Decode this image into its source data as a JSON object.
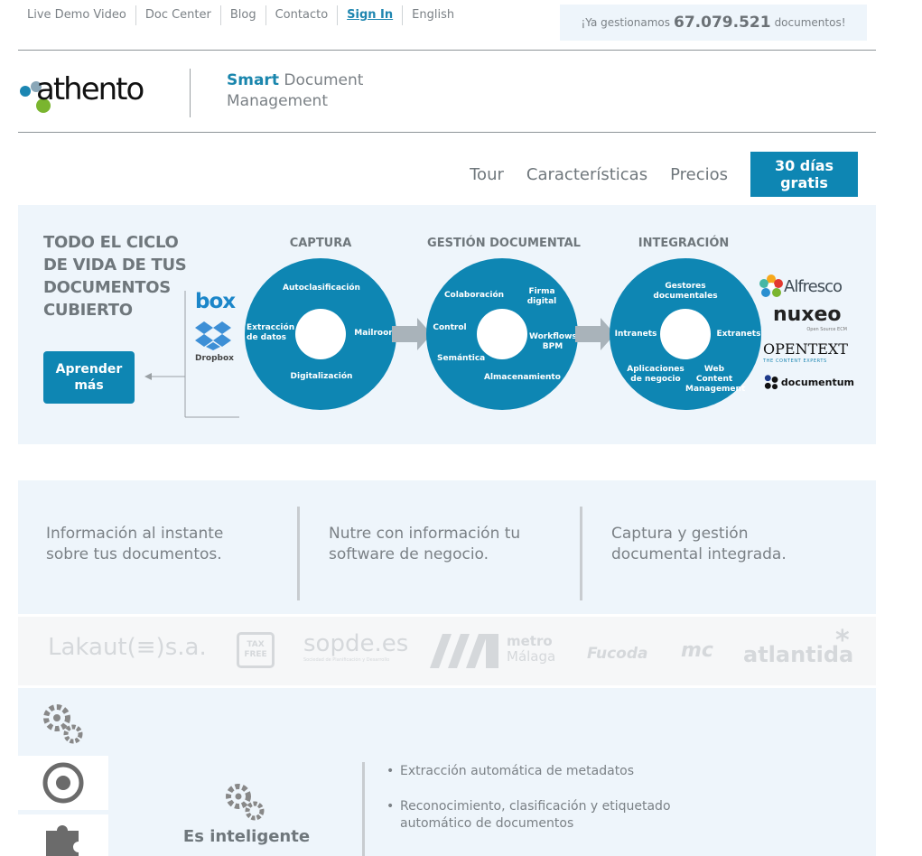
{
  "top_nav": {
    "items": [
      "Live Demo Video",
      "Doc Center",
      "Blog",
      "Contacto",
      "Sign In",
      "English"
    ]
  },
  "counter": {
    "prefix": "¡Ya gestionamos",
    "value": "67.079.521",
    "suffix": "documentos!"
  },
  "brand": {
    "name": "athento",
    "tag_bold": "Smart",
    "tag_rest_1": "Document",
    "tag_rest_2": "Management"
  },
  "main_nav": {
    "tour": "Tour",
    "features": "Características",
    "pricing": "Precios",
    "trial": "30 días gratis"
  },
  "hero": {
    "title": [
      "TODO EL CICLO",
      "DE VIDA DE TUS",
      "DOCUMENTOS",
      "CUBIERTO"
    ],
    "learn_more": [
      "Aprender",
      "más"
    ],
    "sources": {
      "box": "box",
      "dropbox": "Dropbox"
    },
    "stages": [
      {
        "title": "CAPTURA",
        "labels": [
          "Autoclasificación",
          "Extracción\nde datos",
          "Mailroom",
          "Digitalización"
        ]
      },
      {
        "title": "GESTIÓN DOCUMENTAL",
        "labels": [
          "Colaboración",
          "Firma\ndigital",
          "Control",
          "Workflows\nBPM",
          "Semántica",
          "Almacenamiento"
        ]
      },
      {
        "title": "INTEGRACIÓN",
        "labels": [
          "Gestores\ndocumentales",
          "Intranets",
          "Extranets",
          "Aplicaciones\nde negocio",
          "Web Content\nManagement"
        ]
      }
    ],
    "ecm": {
      "alfresco": "Alfresco",
      "nuxeo": "nuxeo",
      "nuxeo_sub": "Open Source ECM",
      "opentext": "OPENTEXT",
      "opentext_sub": "THE CONTENT EXPERTS",
      "documentum": "documentum"
    }
  },
  "features": [
    [
      "Información al instante",
      "sobre tus documentos."
    ],
    [
      "Nutre con información tu",
      "software de negocio."
    ],
    [
      "Captura y gestión",
      "documental integrada."
    ]
  ],
  "clients": {
    "lakaut": "Lakaut(≡)s.a.",
    "taxfree": "TAX FREE",
    "sopde": "sopde.es",
    "sopde_sub": "Sociedad de Planificación y Desarrollo",
    "metro": "metro",
    "metro2": "Málaga",
    "fucoda": "Fucoda",
    "mc": "mc",
    "atlantida": "atlantida"
  },
  "bottom": {
    "heading": "Es inteligente",
    "bullets": [
      [
        "Extracción automática de metadatos"
      ],
      [
        "Reconocimiento, clasificación y etiquetado",
        "automático de documentos"
      ]
    ]
  },
  "colors": {
    "brand_blue": "#0e86b3",
    "hero_bg": "#eef5fb",
    "text_grey": "#6f777c"
  }
}
